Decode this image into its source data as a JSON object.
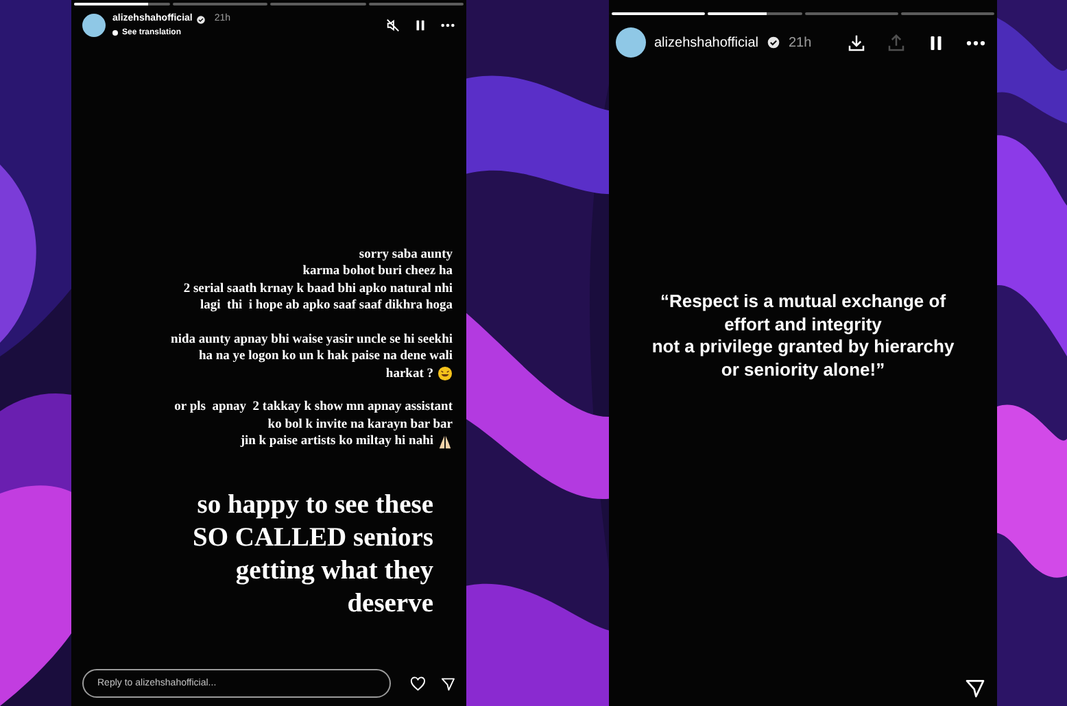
{
  "left_story": {
    "progress": [
      {
        "kind": "current",
        "level": 0.78
      },
      {
        "kind": "upcoming"
      },
      {
        "kind": "upcoming"
      },
      {
        "kind": "upcoming"
      }
    ],
    "username": "alizehshahofficial",
    "verified": true,
    "time": "21h",
    "translation_link": "See translation",
    "actions": [
      {
        "kind": "mute"
      },
      {
        "kind": "pause"
      },
      {
        "kind": "more"
      }
    ],
    "paragraphs": [
      [
        "sorry saba aunty",
        "karma bohot buri cheez ha",
        "2 serial saath krnay k baad bhi apko natural nhi",
        "lagi  thi  i hope ab apko saaf saaf dikhra hoga"
      ],
      [
        "nida aunty apnay bhi waise yasir uncle se hi seekhi",
        "ha na ye logon ko un k hak paise na dene wali",
        {
          "text": "harkat ?",
          "kind": "laughing_emoji"
        }
      ],
      [
        "or pls  apnay  2 takkay k show mn apnay assistant",
        "ko bol k invite na karayn bar bar",
        {
          "text": "jin k paise artists ko miltay hi nahi",
          "kind": "praying_emoji"
        }
      ]
    ],
    "headline": [
      "so happy to see these",
      "SO CALLED seniors",
      "getting what they",
      "deserve"
    ],
    "reply": {
      "placeholder": "Reply to alizehshahofficial..."
    },
    "liked": false
  },
  "right_story": {
    "progress": [
      {
        "kind": "seen"
      },
      {
        "kind": "current",
        "level": 0.62
      },
      {
        "kind": "upcoming"
      },
      {
        "kind": "upcoming"
      }
    ],
    "username": "alizehshahofficial",
    "verified": true,
    "time": "21h",
    "actions": [
      {
        "kind": "download",
        "disabled": false
      },
      {
        "kind": "share",
        "disabled": true
      },
      {
        "kind": "pause"
      },
      {
        "kind": "more"
      }
    ],
    "quote": [
      "“Respect is a mutual exchange of",
      "effort and integrity",
      "not a privilege granted by hierarchy",
      "or seniority alone!”"
    ]
  }
}
